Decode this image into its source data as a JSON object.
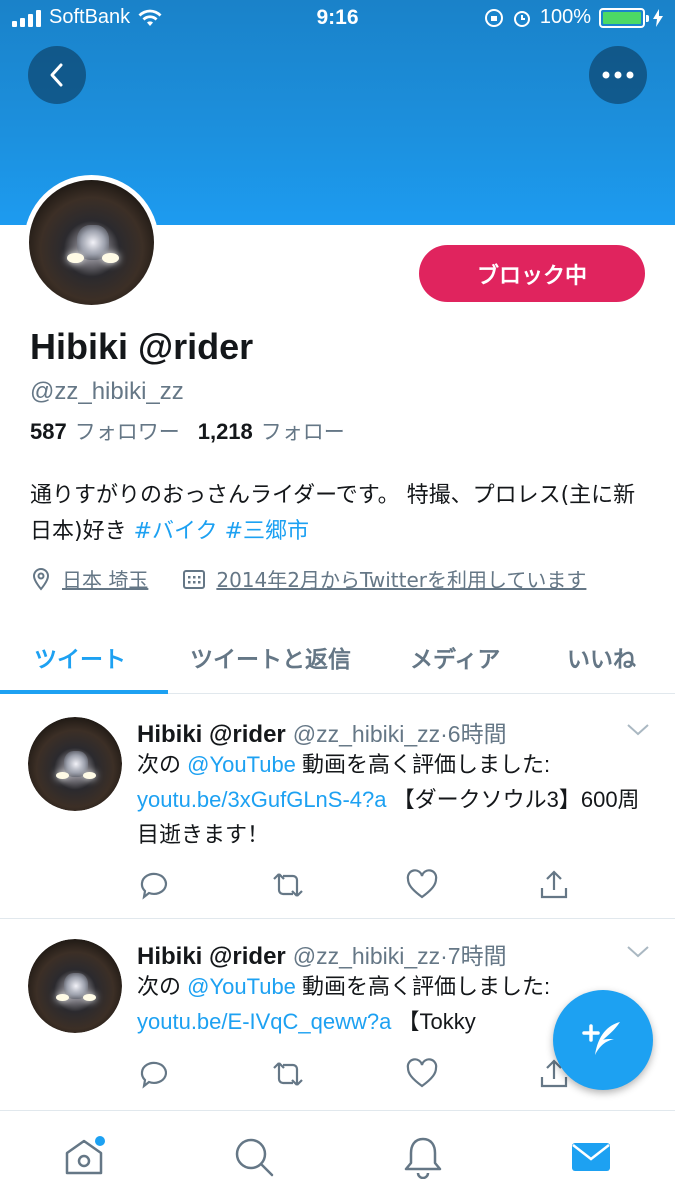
{
  "status_bar": {
    "carrier": "SoftBank",
    "time": "9:16",
    "battery": "100%"
  },
  "profile": {
    "name": "Hibiki @rider",
    "handle": "@zz_hibiki_zz",
    "followers_count": "587",
    "followers_label": "フォロワー",
    "following_count": "1,218",
    "following_label": "フォロー",
    "block_button": "ブロック中",
    "bio_text": "通りすがりのおっさんライダーです。 特撮、プロレス(主に新日本)好き",
    "bio_tags": [
      "#バイク",
      "#三郷市"
    ],
    "location": "日本 埼玉",
    "joined": "2014年2月からTwitterを利用しています"
  },
  "tabs": [
    {
      "label": "ツイート"
    },
    {
      "label": "ツイートと返信"
    },
    {
      "label": "メディア"
    },
    {
      "label": "いいね"
    }
  ],
  "tweets": [
    {
      "name": "Hibiki @rider",
      "handle": "@zz_hibiki_zz",
      "time": "6時間",
      "text_prefix": "次の ",
      "mention": "@YouTube",
      "text_mid": " 動画を高く評価しました: ",
      "link": "youtu.be/3xGufGLnS-4?a",
      "text_suffix": " 【ダークソウル3】600周目逝きます！"
    },
    {
      "name": "Hibiki @rider",
      "handle": "@zz_hibiki_zz",
      "time": "7時間",
      "text_prefix": "次の ",
      "mention": "@YouTube",
      "text_mid": " 動画を高く評価しました: ",
      "link": "youtu.be/E-IVqC_qeww?a",
      "text_suffix": " 【Tokky"
    }
  ],
  "colors": {
    "accent": "#1da1f2",
    "block": "#e0245e",
    "secondary_text": "#657786"
  },
  "icons": [
    "back-icon",
    "more-icon",
    "location-icon",
    "calendar-icon",
    "chevron-down-icon",
    "reply-icon",
    "retweet-icon",
    "like-icon",
    "share-icon",
    "compose-icon",
    "home-icon",
    "search-icon",
    "notifications-icon",
    "messages-icon"
  ]
}
